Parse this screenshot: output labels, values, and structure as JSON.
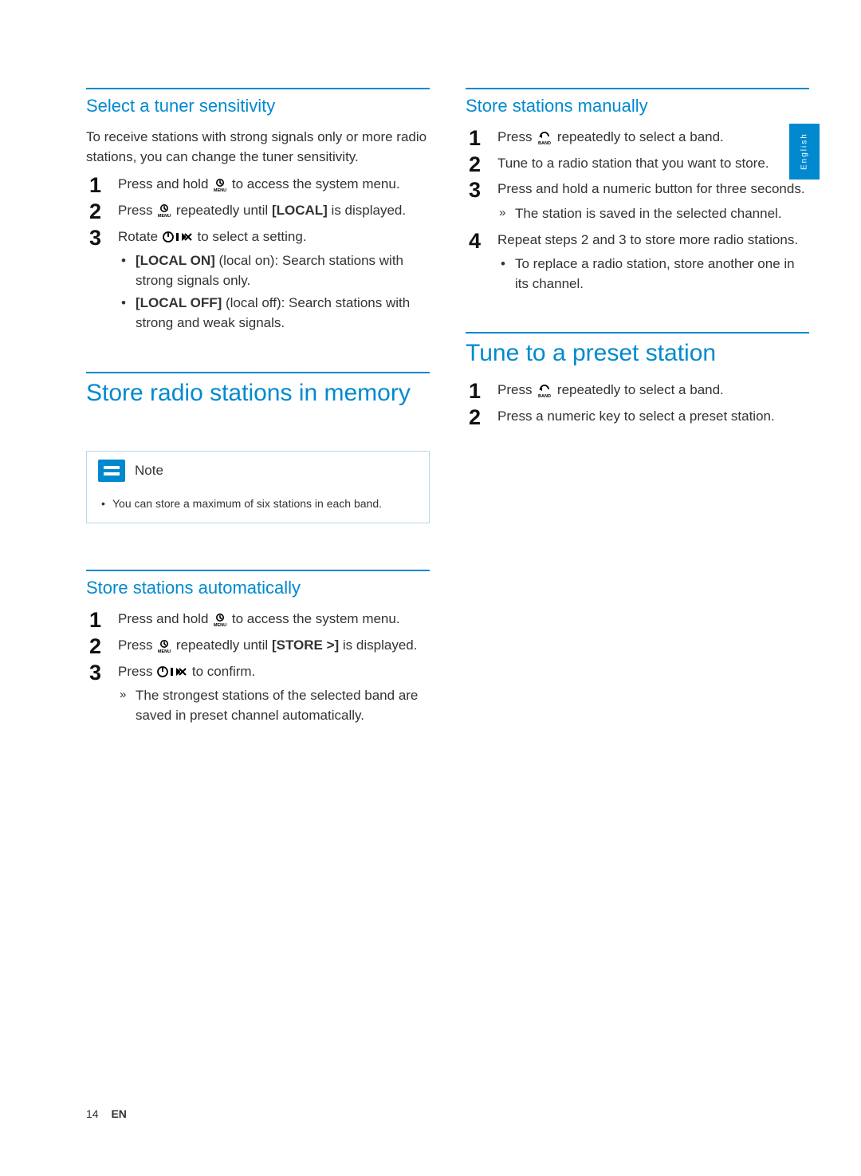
{
  "lang_tab": "English",
  "footer": {
    "page": "14",
    "lang": "EN"
  },
  "left": {
    "sec1": {
      "title": "Select a tuner sensitivity",
      "intro": "To receive stations with strong signals only or more radio stations, you can change the tuner sensitivity.",
      "step1a": "Press and hold ",
      "step1b": " to access the system menu.",
      "step2a": "Press ",
      "step2b": " repeatedly until ",
      "step2_label": "[LOCAL]",
      "step2c": " is displayed.",
      "step3a": "Rotate ",
      "step3b": " to select a setting.",
      "opt1_label": "[LOCAL ON]",
      "opt1_text": " (local on): Search stations with strong signals only.",
      "opt2_label": "[LOCAL OFF]",
      "opt2_text": " (local off): Search stations with strong and weak signals."
    },
    "sec2": {
      "title": "Store radio stations in memory",
      "note_label": "Note",
      "note_text": "You can store a maximum of six stations in each band."
    },
    "sec3": {
      "title": "Store stations automatically",
      "step1a": "Press and hold ",
      "step1b": " to access the system menu.",
      "step2a": "Press ",
      "step2b": " repeatedly until ",
      "step2_label": "[STORE >]",
      "step2c": " is displayed.",
      "step3a": "Press ",
      "step3b": " to confirm.",
      "result": "The strongest stations of the selected band are saved in preset channel automatically."
    }
  },
  "right": {
    "sec1": {
      "title": "Store stations manually",
      "step1a": "Press ",
      "step1b": " repeatedly to select a band.",
      "step2": "Tune to a radio station that you want to store.",
      "step3": "Press and hold a numeric button for three seconds.",
      "step3_result": "The station is saved in the selected channel.",
      "step4": "Repeat steps 2 and 3 to store more radio stations.",
      "step4_bullet": "To replace a radio station, store another one in its channel."
    },
    "sec2": {
      "title": "Tune to a preset station",
      "step1a": "Press ",
      "step1b": " repeatedly to select a band.",
      "step2": "Press a numeric key to select a preset station."
    }
  }
}
